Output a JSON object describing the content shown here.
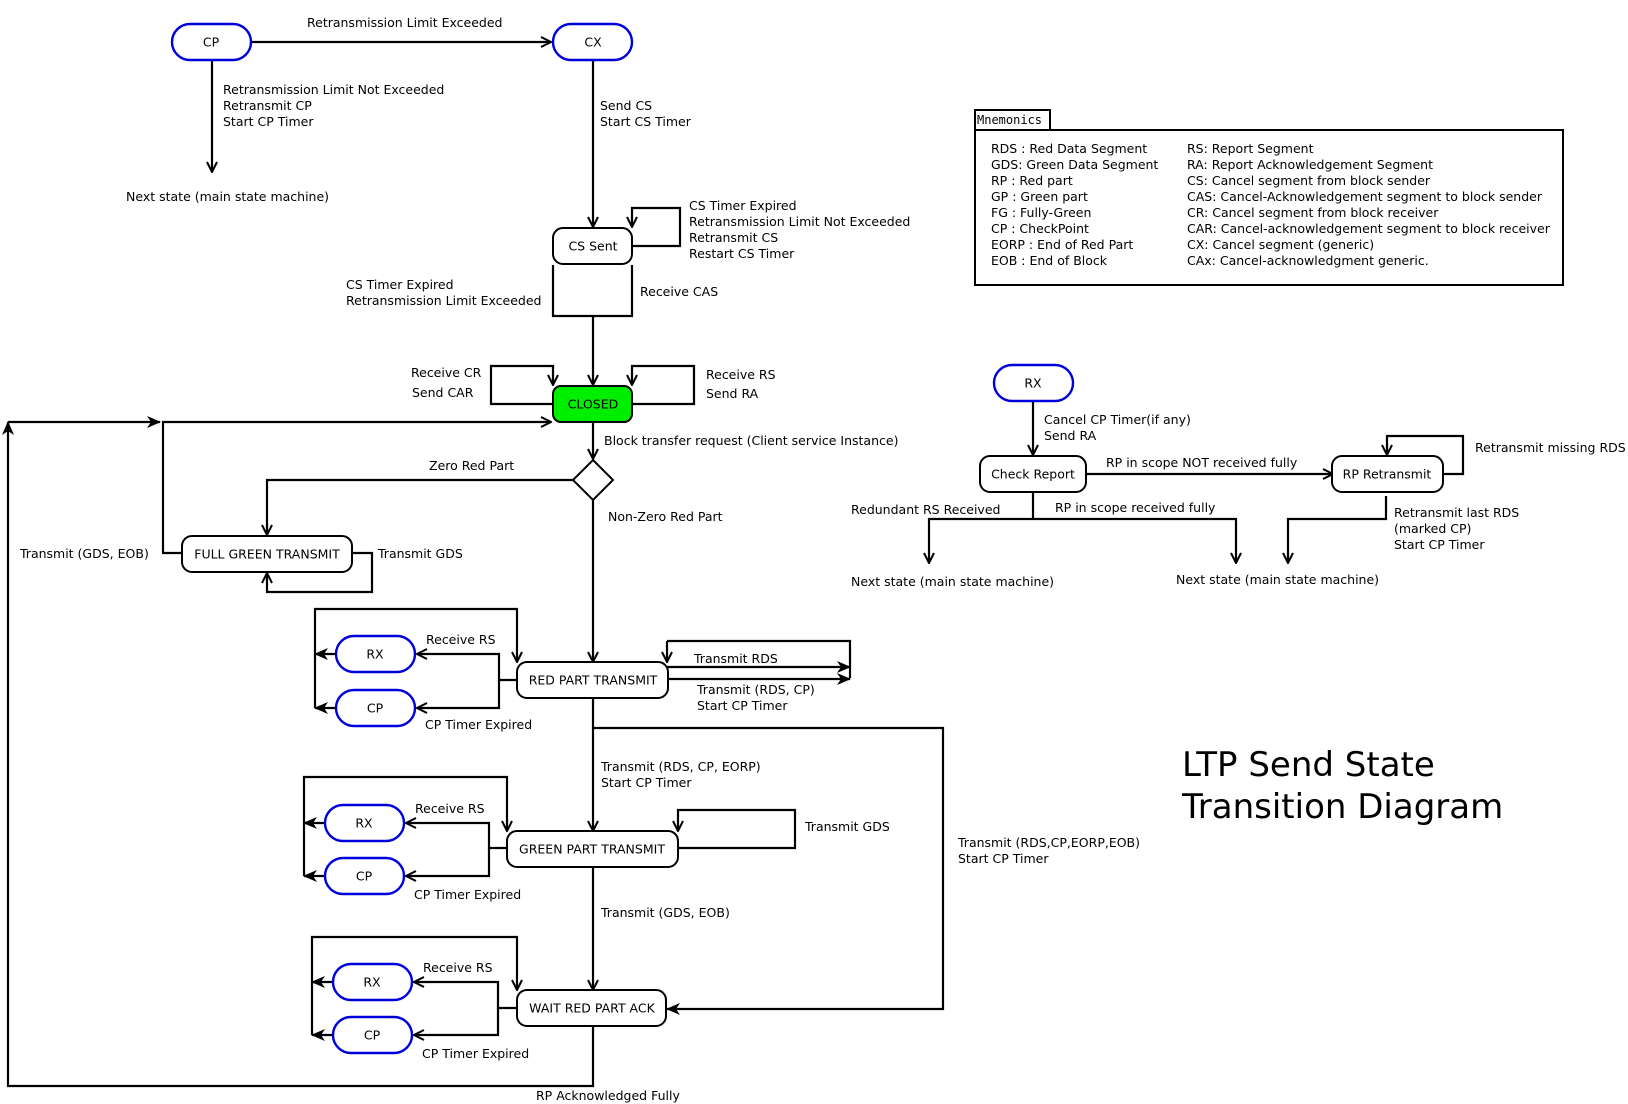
{
  "title": [
    "LTP Send State",
    "Transition Diagram"
  ],
  "states": {
    "cs_sent": "CS Sent",
    "closed": "CLOSED",
    "full_green": "FULL GREEN TRANSMIT",
    "red_part": "RED PART TRANSMIT",
    "green_part": "GREEN PART TRANSMIT",
    "wait_ack": "WAIT RED PART ACK",
    "check_report": "Check Report",
    "rp_retransmit": "RP Retransmit"
  },
  "terminals": {
    "cp": "CP",
    "cx": "CX",
    "rx": "RX"
  },
  "labels": {
    "retx_limit_exceeded": "Retransmission Limit Exceeded",
    "cp_not_exceeded": [
      "Retransmission Limit Not Exceeded",
      "Retransmit CP",
      "Start CP Timer"
    ],
    "next_state": "Next state (main state machine)",
    "send_cs": [
      "Send CS",
      "Start CS Timer"
    ],
    "cs_self": [
      "CS Timer Expired",
      "Retransmission Limit Not Exceeded",
      "Retransmit CS",
      "Restart CS Timer"
    ],
    "cs_exceeded": [
      "CS Timer Expired",
      "Retransmission Limit Exceeded"
    ],
    "receive_cas": "Receive CAS",
    "receive_cr": "Receive CR",
    "send_car": "Send CAR",
    "receive_rs": "Receive RS",
    "send_ra": "Send RA",
    "block_transfer": "Block transfer request (Client service Instance)",
    "zero_red": "Zero Red Part",
    "nonzero_red": "Non-Zero Red Part",
    "transmit_gds_eob": "Transmit (GDS, EOB)",
    "transmit_gds": "Transmit GDS",
    "transmit_rds": "Transmit RDS",
    "transmit_rds_cp": [
      "Transmit (RDS, CP)",
      "Start CP Timer"
    ],
    "cp_timer_expired": "CP Timer Expired",
    "transmit_rds_cp_eorp": [
      "Transmit (RDS, CP, EORP)",
      "Start CP Timer"
    ],
    "transmit_all": [
      "Transmit (RDS,CP,EORP,EOB)",
      "Start CP Timer"
    ],
    "rp_ack_fully": "RP Acknowledged Fully",
    "cancel_cp": [
      "Cancel CP Timer(if any)",
      "Send RA"
    ],
    "rp_not_received": "RP in scope NOT received fully",
    "retransmit_missing": "Retransmit missing RDS",
    "redundant_rs": "Redundant RS Received",
    "rp_received": "RP in scope received fully",
    "retransmit_last": [
      "Retransmit last RDS",
      "(marked CP)",
      "Start CP Timer"
    ]
  },
  "mnemonics": {
    "tab": "Mnemonics",
    "left": [
      "RDS : Red Data Segment",
      "GDS: Green Data Segment",
      "RP : Red part",
      "GP : Green part",
      "FG : Fully-Green",
      "CP : CheckPoint",
      "EORP : End of Red Part",
      "EOB : End of Block"
    ],
    "right": [
      "RS: Report Segment",
      "RA: Report Acknowledgement Segment",
      "CS: Cancel segment from block sender",
      "CAS: Cancel-Acknowledgement segment to block sender",
      "CR: Cancel segment from block receiver",
      "CAR: Cancel-acknowledgement segment to block receiver",
      "CX: Cancel segment (generic)",
      "CAx: Cancel-acknowledgment generic."
    ]
  }
}
